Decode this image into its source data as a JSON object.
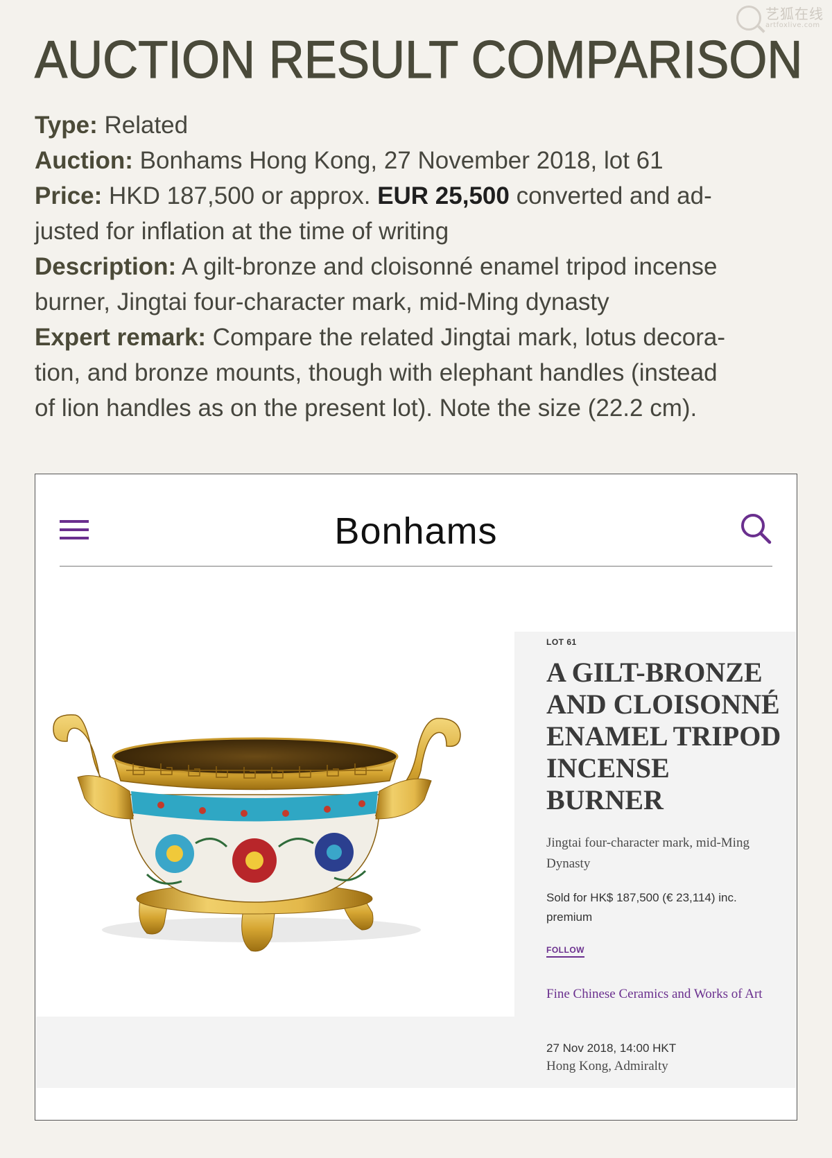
{
  "watermark": {
    "cn": "艺狐在线",
    "en": "artfoxlive.com"
  },
  "page": {
    "title": "AUCTION RESULT COMPARISON"
  },
  "info": {
    "type_label": "Type:",
    "type_value": " Related",
    "auction_label": "Auction:",
    "auction_value": " Bonhams Hong Kong, 27 November 2018, lot 61",
    "price_label": "Price:",
    "price_prefix": " HKD 187,500 or approx. ",
    "price_eur": "EUR 25,500",
    "price_suffix_1": " converted and ad-",
    "price_line2": "justed for inflation at the time of writing",
    "description_label": "Description:",
    "description_line1": " A gilt-bronze and cloisonné enamel tripod incense",
    "description_line2": "burner, Jingtai four-character mark, mid-Ming dynasty",
    "remark_label": "Expert remark:",
    "remark_line1": " Compare the related Jingtai mark, lotus decora-",
    "remark_line2": "tion, and bronze mounts, though with elephant handles (instead",
    "remark_line3": "of lion handles as on the present lot). Note the size (22.2 cm)."
  },
  "screenshot": {
    "brand": "Bonhams",
    "icons": {
      "menu": "hamburger-menu-icon",
      "search": "search-icon"
    },
    "accent_color": "#6a2f8e",
    "image_alt": "gilt-bronze and cloisonné enamel tripod incense burner",
    "lot": {
      "label": "LOT 61",
      "title_line1": "A GILT-BRONZE",
      "title_line2": "AND CLOISONNÉ",
      "title_line3": "ENAMEL TRIPOD",
      "title_line4": "INCENSE",
      "title_line5": "BURNER",
      "subtitle": "Jingtai four-character mark, mid-Ming Dynasty",
      "sold": "Sold for HK$ 187,500 (€ 23,114) inc. premium",
      "follow": "FOLLOW",
      "sale_name": "Fine Chinese Ceramics and Works of Art",
      "sale_date": "27 Nov 2018, 14:00 HKT",
      "sale_location": "Hong Kong, Admiralty"
    }
  }
}
